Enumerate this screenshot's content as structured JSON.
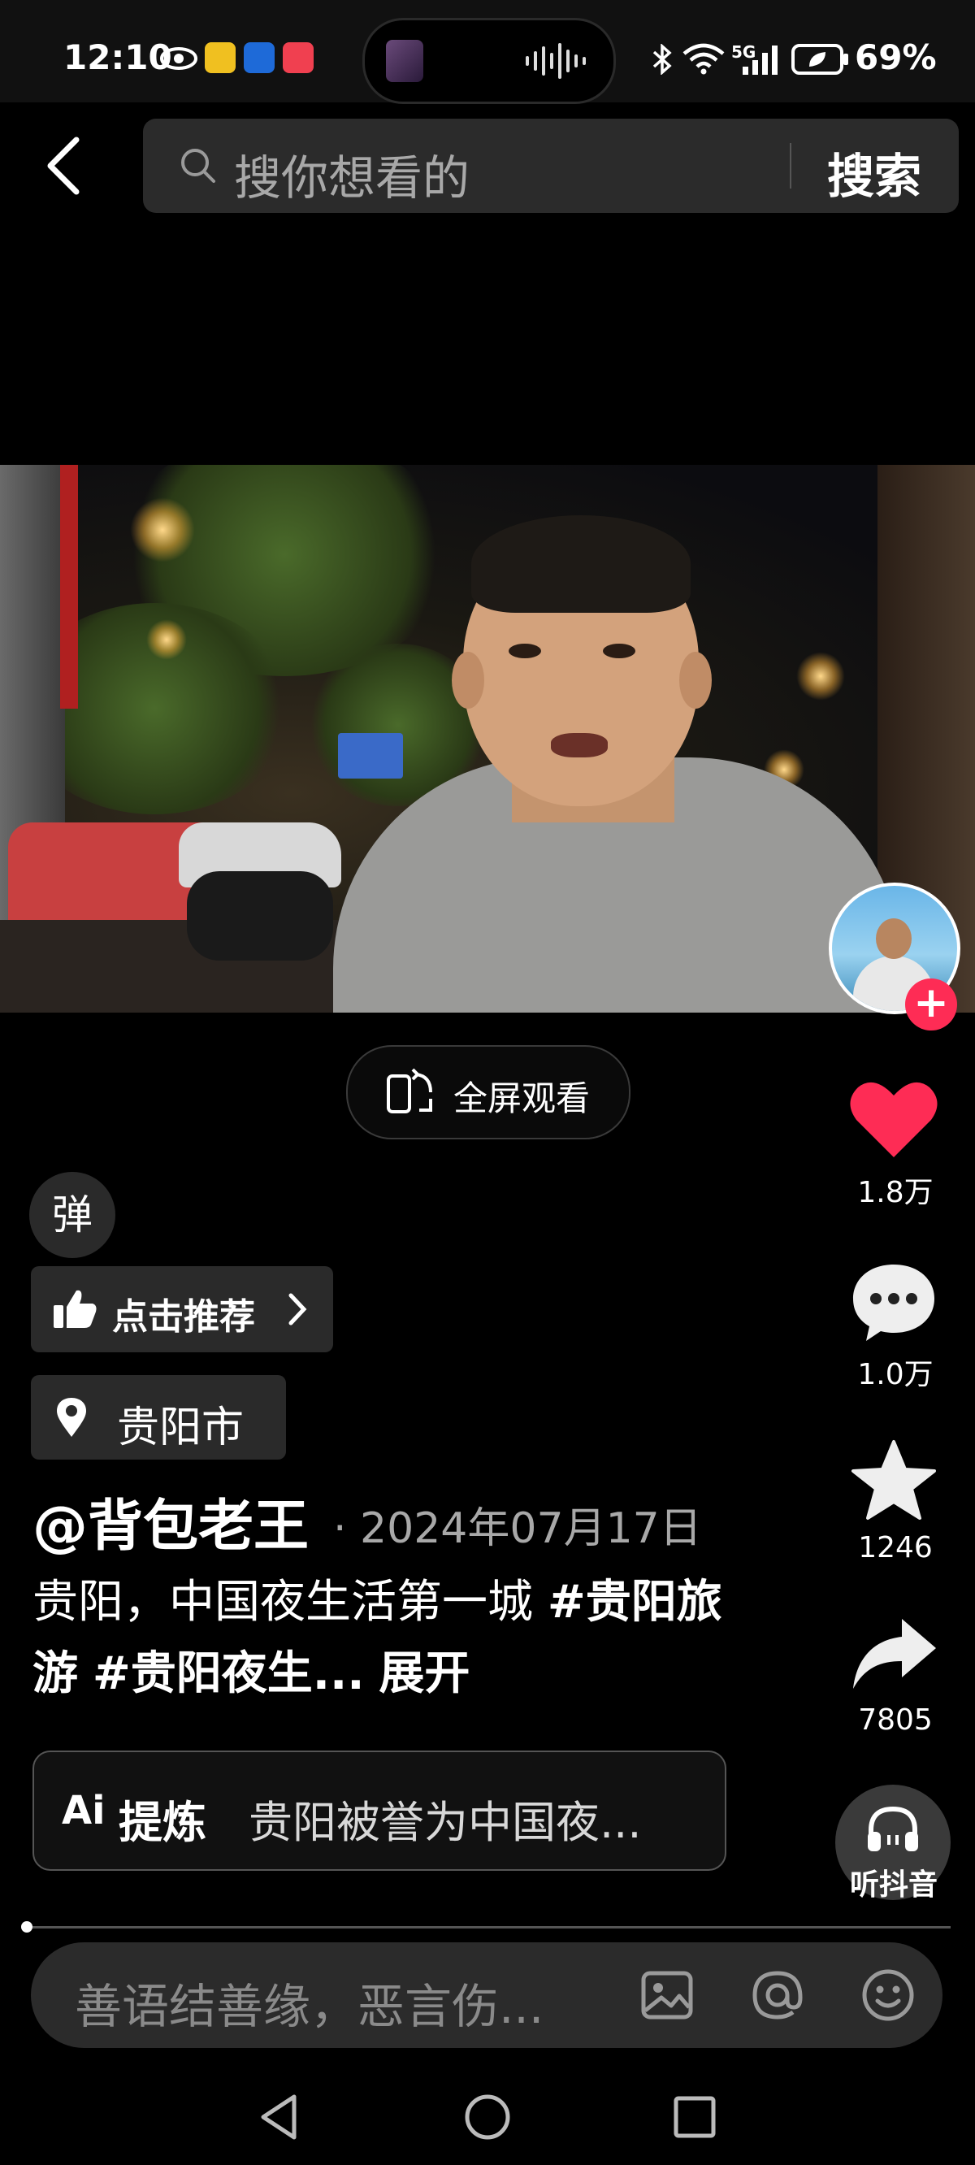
{
  "status_bar": {
    "time": "12:10",
    "network": "5G",
    "battery": "69%"
  },
  "search": {
    "back_icon": "chevron-left-icon",
    "placeholder": "搜你想看的",
    "button_label": "搜索"
  },
  "video": {
    "fullscreen_label": "全屏观看"
  },
  "actions": {
    "likes": "1.8万",
    "comments": "1.0万",
    "favorites": "1246",
    "shares": "7805",
    "listen_label": "听抖音"
  },
  "overlay": {
    "danmu_label": "弹",
    "recommend_label": "点击推荐",
    "location": "贵阳市"
  },
  "post": {
    "author": "@背包老王",
    "date": "· 2024年07月17日",
    "description": "贵阳，中国夜生活第一城 ",
    "tag1": "#贵阳旅游",
    "tag2": "#贵阳夜生...",
    "expand": "展开"
  },
  "ai_summary": {
    "icon_label": "Ai",
    "title": "提炼",
    "text": "贵阳被誉为中国夜..."
  },
  "comment": {
    "placeholder": "善语结善缘，恶言伤..."
  },
  "colors": {
    "accent": "#fe2c55",
    "background": "#000000"
  },
  "progress": 0.01
}
